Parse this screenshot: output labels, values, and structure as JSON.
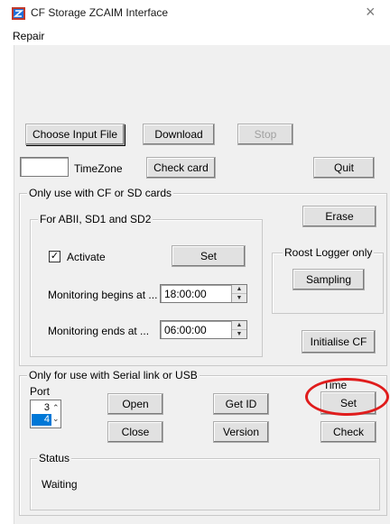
{
  "window": {
    "title": "CF Storage ZCAIM Interface",
    "close_glyph": "×"
  },
  "menu": {
    "items": [
      "Repair"
    ]
  },
  "toolbar": {
    "choose_input_label": "Choose Input File",
    "download_label": "Download",
    "stop_label": "Stop",
    "timezone_value": "",
    "timezone_label": "TimeZone",
    "check_card_label": "Check card",
    "quit_label": "Quit"
  },
  "cf_group": {
    "label": "Only use with CF or SD cards",
    "erase_label": "Erase",
    "abii": {
      "label": "For ABII, SD1 and SD2",
      "activate_label": "Activate",
      "activate_checked": true,
      "check_glyph": "✓",
      "set_label": "Set",
      "begins_label": "Monitoring begins at ...",
      "begins_value": "18:00:00",
      "ends_label": "Monitoring ends at ...",
      "ends_value": "06:00:00"
    },
    "roost": {
      "label": "Roost Logger only",
      "sampling_label": "Sampling"
    },
    "initialise_label": "Initialise CF"
  },
  "serial_group": {
    "label": "Only for use with Serial link or USB",
    "port_label": "Port",
    "ports": [
      "3",
      "4"
    ],
    "selected_port": "4",
    "open_label": "Open",
    "close_label": "Close",
    "get_id_label": "Get ID",
    "version_label": "Version",
    "time_label": "Time",
    "set_label": "Set",
    "check_label": "Check",
    "status": {
      "label": "Status",
      "text": "Waiting"
    }
  },
  "colors": {
    "highlight_oval": "#e01c1c",
    "selection": "#0078d7",
    "client_bg": "#f0f0f0"
  },
  "icons": {
    "app": "app-logo-icon",
    "spin_up": "▲",
    "spin_down": "▼"
  }
}
